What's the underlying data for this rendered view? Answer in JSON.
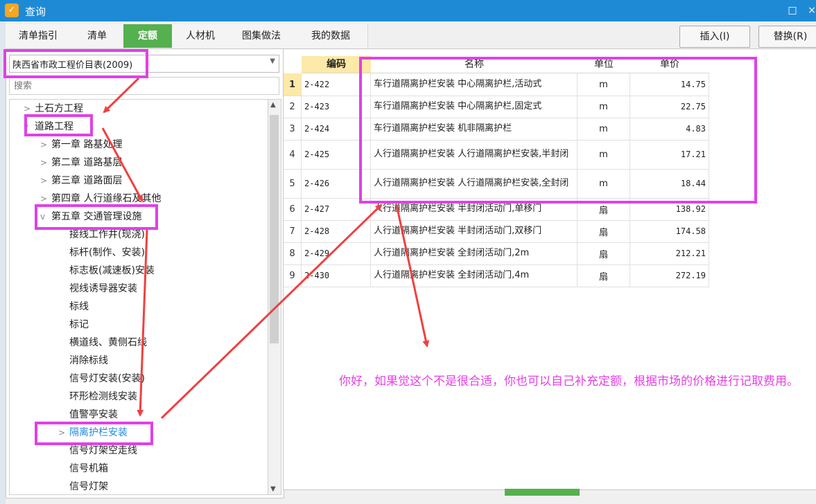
{
  "window": {
    "title": "查询",
    "app_icon": "app-logo-icon",
    "maximize_glyph": "□",
    "close_glyph": "×"
  },
  "tabs": [
    {
      "label": "清单指引"
    },
    {
      "label": "清单"
    },
    {
      "label": "定额",
      "active": true
    },
    {
      "label": "人材机"
    },
    {
      "label": "图集做法"
    },
    {
      "label": "我的数据"
    }
  ],
  "actions": {
    "insert": "插入(I)",
    "replace": "替换(R)"
  },
  "library": {
    "selected": "陕西省市政工程价目表(2009)"
  },
  "search": {
    "placeholder": "搜索"
  },
  "tree": [
    {
      "label": "土石方工程",
      "level": 0,
      "expander": ">"
    },
    {
      "label": "道路工程",
      "level": 0,
      "expander": "v"
    },
    {
      "label": "第一章 路基处理",
      "level": 1,
      "expander": ">"
    },
    {
      "label": "第二章 道路基层",
      "level": 1,
      "expander": ">"
    },
    {
      "label": "第三章 道路面层",
      "level": 1,
      "expander": ">"
    },
    {
      "label": "第四章 人行道缘石及其他",
      "level": 1,
      "expander": ">"
    },
    {
      "label": "第五章 交通管理设施",
      "level": 1,
      "expander": "v"
    },
    {
      "label": "接线工作井(现浇)",
      "level": 2,
      "expander": ""
    },
    {
      "label": "标杆(制作、安装)",
      "level": 2,
      "expander": ""
    },
    {
      "label": "标志板(减速板)安装",
      "level": 2,
      "expander": ""
    },
    {
      "label": "视线诱导器安装",
      "level": 2,
      "expander": ""
    },
    {
      "label": "标线",
      "level": 2,
      "expander": ""
    },
    {
      "label": "标记",
      "level": 2,
      "expander": ""
    },
    {
      "label": "横道线、黄侧石线",
      "level": 2,
      "expander": ""
    },
    {
      "label": "消除标线",
      "level": 2,
      "expander": ""
    },
    {
      "label": "信号灯安装(安装)",
      "level": 2,
      "expander": ""
    },
    {
      "label": "环形检测线安装",
      "level": 2,
      "expander": ""
    },
    {
      "label": "值警亭安装",
      "level": 2,
      "expander": ""
    },
    {
      "label": "隔离护栏安装",
      "level": 2,
      "expander": ">",
      "selected": true
    },
    {
      "label": "信号灯架空走线",
      "level": 2,
      "expander": ""
    },
    {
      "label": "信号机箱",
      "level": 2,
      "expander": ""
    },
    {
      "label": "信号灯架",
      "level": 2,
      "expander": ""
    }
  ],
  "table": {
    "headers": {
      "code": "编码",
      "name": "名称",
      "unit": "单位",
      "price": "单价"
    },
    "rows": [
      {
        "n": "1",
        "code": "2-422",
        "name": "车行道隔离护栏安装 中心隔离护栏,活动式",
        "unit": "m",
        "price": "14.75"
      },
      {
        "n": "2",
        "code": "2-423",
        "name": "车行道隔离护栏安装 中心隔离护栏,固定式",
        "unit": "m",
        "price": "22.75"
      },
      {
        "n": "3",
        "code": "2-424",
        "name": "车行道隔离护栏安装 机非隔离护栏",
        "unit": "m",
        "price": "4.83"
      },
      {
        "n": "4",
        "code": "2-425",
        "name": "人行道隔离护栏安装 人行道隔离护栏安装,半封闭",
        "unit": "m",
        "price": "17.21"
      },
      {
        "n": "5",
        "code": "2-426",
        "name": "人行道隔离护栏安装 人行道隔离护栏安装,全封闭",
        "unit": "m",
        "price": "18.44"
      },
      {
        "n": "6",
        "code": "2-427",
        "name": "人行道隔离护栏安装 半封闭活动门,单移门",
        "unit": "扇",
        "price": "138.92"
      },
      {
        "n": "7",
        "code": "2-428",
        "name": "人行道隔离护栏安装 半封闭活动门,双移门",
        "unit": "扇",
        "price": "174.58"
      },
      {
        "n": "8",
        "code": "2-429",
        "name": "人行道隔离护栏安装 全封闭活动门,2m",
        "unit": "扇",
        "price": "212.21"
      },
      {
        "n": "9",
        "code": "2-430",
        "name": "人行道隔离护栏安装 全封闭活动门,4m",
        "unit": "扇",
        "price": "272.19"
      }
    ]
  },
  "annotation": {
    "comment": "你好，如果觉这个不是很合适，你也可以自己补充定额，根据市场的价格进行记取费用。",
    "highlight_color": "#e040e8",
    "arrow_color": "#f04040"
  },
  "colors": {
    "titlebar": "#1e8ad6",
    "active_tab": "#55b04f"
  }
}
